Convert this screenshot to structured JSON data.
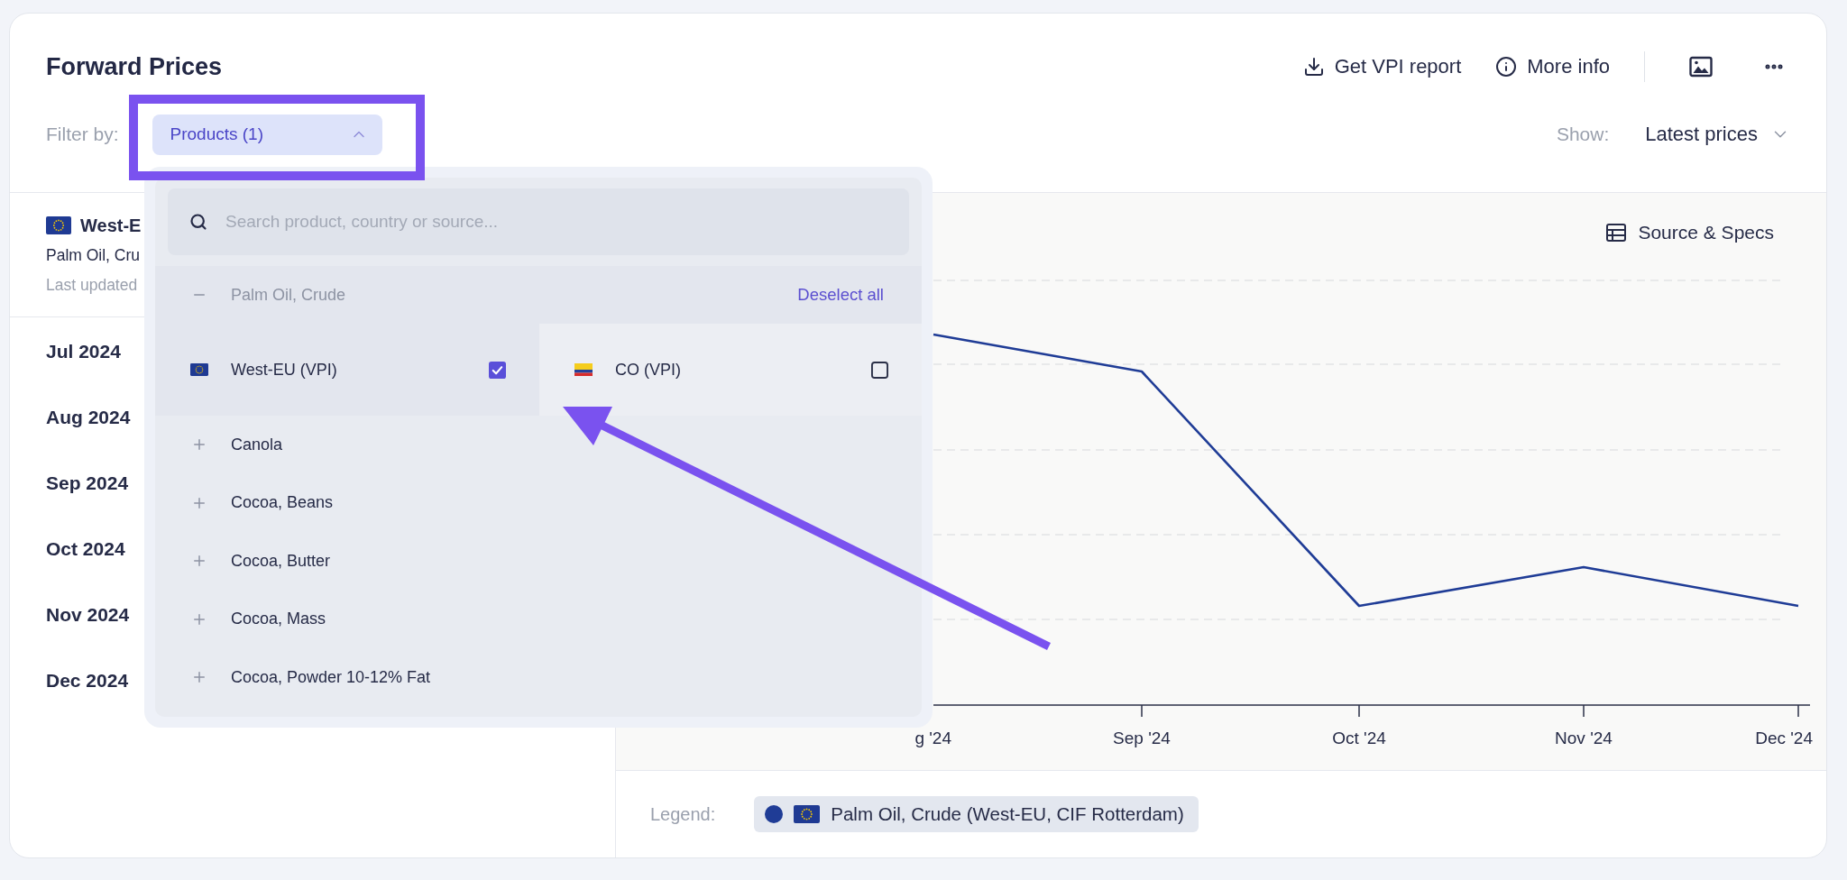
{
  "header": {
    "title": "Forward Prices",
    "actions": [
      {
        "kind": "download",
        "label": "Get VPI report"
      },
      {
        "kind": "info",
        "label": "More info"
      },
      {
        "kind": "image"
      },
      {
        "kind": "more"
      }
    ]
  },
  "filter": {
    "label": "Filter by:",
    "button": {
      "label": "Products (1)",
      "expanded": true
    }
  },
  "show": {
    "label": "Show:",
    "value": "Latest prices",
    "expanded": false
  },
  "series": {
    "title": "West-E",
    "product": "Palm Oil, Cru",
    "updated": "Last updated"
  },
  "months": [
    "Jul 2024",
    "Aug 2024",
    "Sep 2024",
    "Oct 2024",
    "Nov 2024",
    "Dec 2024"
  ],
  "chart": {
    "source_button": "Source & Specs",
    "x_labels": [
      "g '24",
      "Sep '24",
      "Oct '24",
      "Nov '24",
      "Dec '24"
    ]
  },
  "legend": {
    "label": "Legend:",
    "items": [
      {
        "label": "Palm Oil, Crude (West-EU, CIF Rotterdam)",
        "color": "#1f3c96"
      }
    ]
  },
  "dropdown": {
    "search": {
      "placeholder": "Search product, country or source..."
    },
    "deselect_label": "Deselect all",
    "products": [
      {
        "name": "Palm Oil, Crude",
        "expanded": true,
        "sources": [
          {
            "kind": "eu",
            "name": "West-EU (VPI)",
            "checked": true
          },
          {
            "kind": "co",
            "name": "CO (VPI)",
            "checked": false
          }
        ]
      },
      {
        "name": "Canola",
        "expanded": false
      },
      {
        "name": "Cocoa, Beans",
        "expanded": false
      },
      {
        "name": "Cocoa, Butter",
        "expanded": false
      },
      {
        "name": "Cocoa, Mass",
        "expanded": false
      },
      {
        "name": "Cocoa, Powder 10-12% Fat",
        "expanded": false
      }
    ]
  }
}
